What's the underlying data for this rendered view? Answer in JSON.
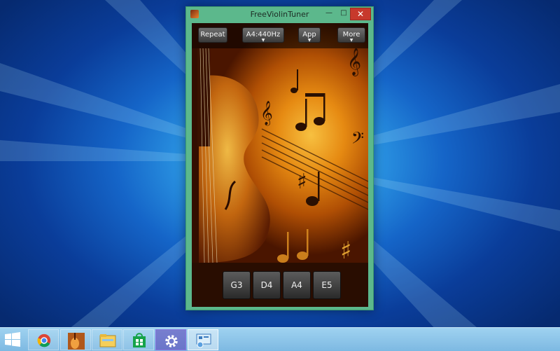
{
  "window": {
    "title": "FreeViolinTuner",
    "minimize_glyph": "—",
    "maximize_glyph": "□",
    "close_glyph": "✕"
  },
  "toolbar": {
    "repeat": "Repeat",
    "tuning": "A4:440Hz",
    "app": "App",
    "more": "More"
  },
  "notes": [
    "G3",
    "D4",
    "A4",
    "E5"
  ],
  "taskbar": {
    "items": [
      "start-icon",
      "chrome-icon",
      "violin-app-icon",
      "file-explorer-icon",
      "store-icon",
      "settings-icon",
      "control-panel-icon"
    ]
  },
  "colors": {
    "window_frame": "#5cb88c",
    "close_button": "#c7392c",
    "taskbar": "#8fc6ea"
  }
}
